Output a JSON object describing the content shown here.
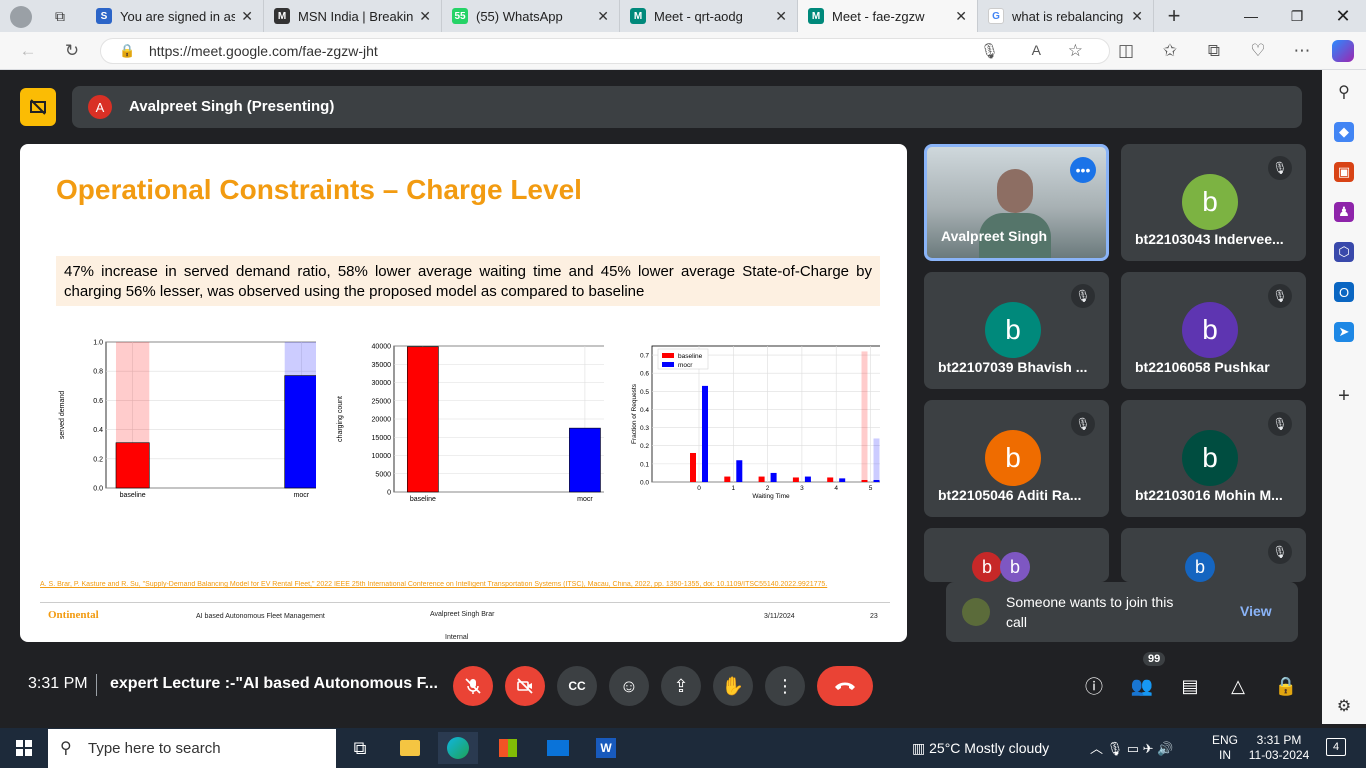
{
  "browser": {
    "tabs": [
      {
        "title": "You are signed in as s",
        "color": "#2c65c8",
        "glyph": "S"
      },
      {
        "title": "MSN India | Breaking",
        "color": "#333333",
        "glyph": "M"
      },
      {
        "title": "(55) WhatsApp",
        "color": "#25d366",
        "glyph": "55"
      },
      {
        "title": "Meet - qrt-aodg",
        "color": "#00897b",
        "glyph": "M"
      },
      {
        "title": "Meet - fae-zgzw",
        "color": "#00897b",
        "glyph": "M"
      },
      {
        "title": "what is rebalancing w",
        "color": "#ffffff",
        "glyph": "G"
      }
    ],
    "url": "https://meet.google.com/fae-zgzw-jht"
  },
  "meet": {
    "presenter_initial": "A",
    "presenter_label": "Avalpreet Singh (Presenting)",
    "time": "3:31 PM",
    "meeting_title": "expert Lecture :-\"AI based Autonomous F...",
    "participant_count": "99",
    "join_toast": "Someone wants to join this call",
    "join_view": "View",
    "participants": [
      {
        "name": "Avalpreet Singh",
        "initial": "",
        "color": "#6b7a7c"
      },
      {
        "name": "bt22103043 Indervee...",
        "initial": "b",
        "color": "#7cb342"
      },
      {
        "name": "bt22107039 Bhavish ...",
        "initial": "b",
        "color": "#00897b"
      },
      {
        "name": "bt22106058 Pushkar",
        "initial": "b",
        "color": "#5e35b1"
      },
      {
        "name": "bt22105046 Aditi Ra...",
        "initial": "b",
        "color": "#ef6c00"
      },
      {
        "name": "bt22103016 Mohin M...",
        "initial": "b",
        "color": "#004d40"
      },
      {
        "name": "",
        "initial": "b",
        "color": "#c62828"
      },
      {
        "name": "",
        "initial": "b",
        "color": "#1565c0"
      }
    ]
  },
  "slide": {
    "title": "Operational Constraints – Charge Level",
    "summary": "47% increase in served demand ratio, 58% lower average waiting time and 45% lower average State-of-Charge by charging 56% lesser, was observed using the proposed model as compared to baseline",
    "citation": "A. S. Brar, P. Kasture and R. Su, \"Supply-Demand Balancing Model for EV Rental Fleet,\" 2022 IEEE 25th International Conference on Intelligent Transportation Systems (ITSC), Macau, China, 2022, pp. 1350-1355, doi: 10.1109/ITSC55140.2022.9921775.",
    "footer_logo": "Ontinental",
    "footer_course": "AI based Autonomous Fleet Management",
    "footer_author": "Avalpreet Singh Brar",
    "footer_date": "3/11/2024",
    "footer_page": "23",
    "footer_class": "Internal"
  },
  "chart_data": [
    {
      "type": "bar",
      "categories": [
        "baseline",
        "mocr"
      ],
      "series": [
        {
          "values": [
            0.31,
            0.77
          ],
          "colors": [
            "#ff0000",
            "#0000ff"
          ]
        }
      ],
      "background_values": [
        1.0,
        1.0
      ],
      "ylabel": "served demand",
      "ylim": [
        0,
        1.0
      ],
      "yticks": [
        "0.0",
        "0.2",
        "0.4",
        "0.6",
        "0.8",
        "1.0"
      ],
      "grid": true
    },
    {
      "type": "bar",
      "categories": [
        "baseline",
        "mocr"
      ],
      "series": [
        {
          "values": [
            39800,
            17500
          ],
          "colors": [
            "#ff0000",
            "#0000ff"
          ]
        }
      ],
      "ylabel": "charging count",
      "ylim": [
        0,
        40000
      ],
      "yticks": [
        "0",
        "5000",
        "10000",
        "15000",
        "20000",
        "25000",
        "30000",
        "35000",
        "40000"
      ],
      "grid": true
    },
    {
      "type": "bar",
      "x": [
        0,
        1,
        2,
        3,
        4,
        5
      ],
      "series": [
        {
          "name": "baseline",
          "values": [
            0.16,
            0.03,
            0.03,
            0.025,
            0.025,
            0.72
          ],
          "color": "#ff0000"
        },
        {
          "name": "mocr",
          "values": [
            0.53,
            0.12,
            0.05,
            0.03,
            0.02,
            0.24
          ],
          "color": "#0000ff"
        }
      ],
      "xlabel": "Waiting Time",
      "ylabel": "Fraction of Requests",
      "ylim": [
        0,
        0.75
      ],
      "yticks": [
        "0.0",
        "0.1",
        "0.2",
        "0.3",
        "0.4",
        "0.5",
        "0.6",
        "0.7"
      ],
      "legend": "top-left",
      "grid": true
    }
  ],
  "taskbar": {
    "search_placeholder": "Type here to search",
    "weather": "25°C  Mostly cloudy",
    "lang1": "ENG",
    "lang2": "IN",
    "clock_time": "3:31 PM",
    "clock_date": "11-03-2024",
    "notif_count": "4"
  }
}
